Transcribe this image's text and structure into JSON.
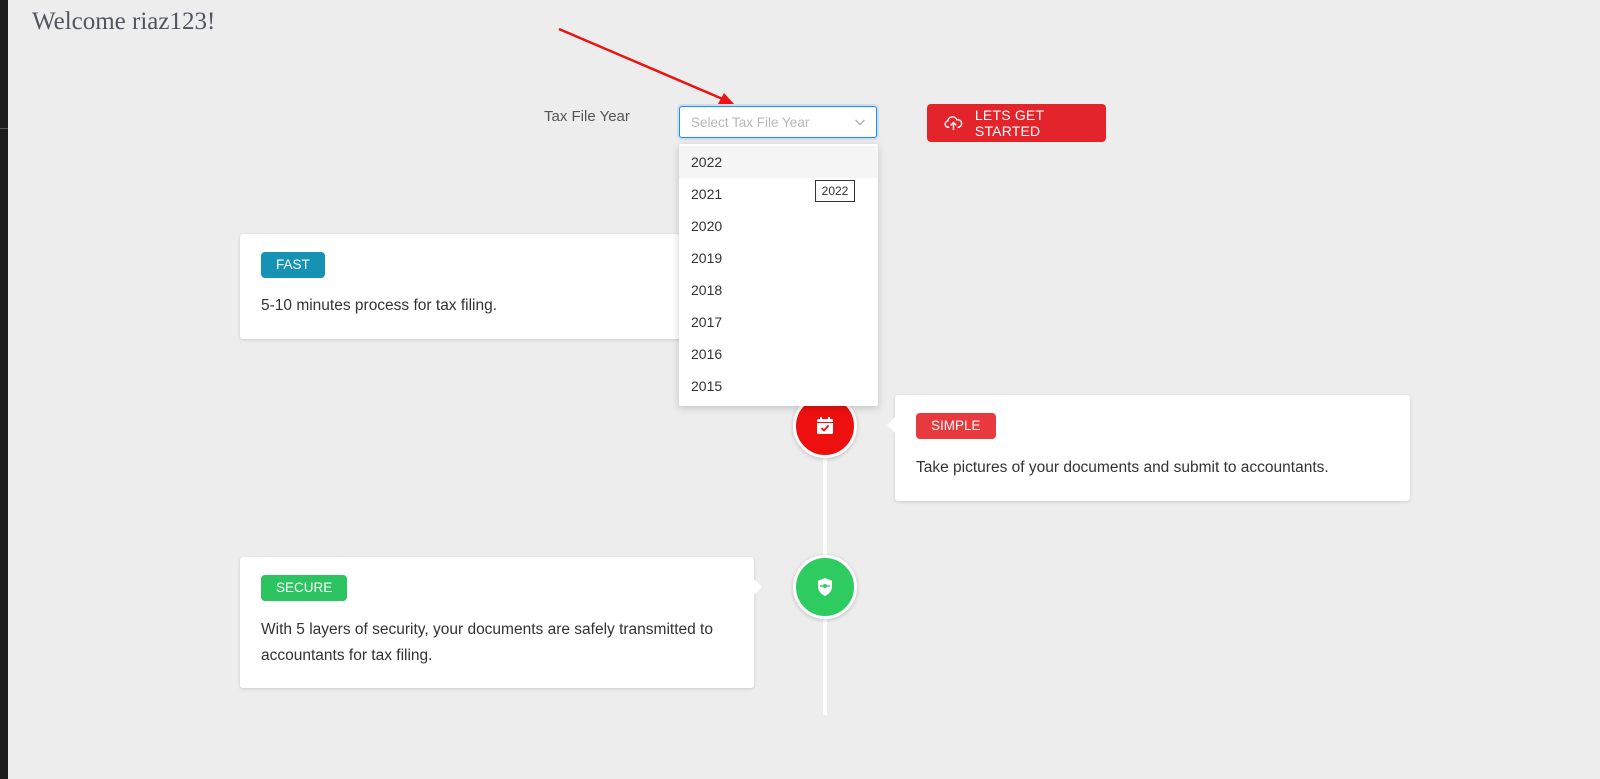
{
  "welcome": "Welcome riaz123!",
  "form": {
    "year_label": "Tax File Year",
    "select_placeholder": "Select Tax File Year",
    "start_button": "LETS GET STARTED"
  },
  "dropdown": {
    "options": [
      "2022",
      "2021",
      "2020",
      "2019",
      "2018",
      "2017",
      "2016",
      "2015"
    ],
    "tooltip": "2022"
  },
  "timeline": {
    "fast": {
      "badge": "FAST",
      "text": "5-10 minutes process for tax filing."
    },
    "simple": {
      "badge": "SIMPLE",
      "text": "Take pictures of your documents and submit to accountants."
    },
    "secure": {
      "badge": "SECURE",
      "text": "With 5 layers of security, your documents are safely transmitted to accountants for tax filing."
    }
  },
  "colors": {
    "primary_red": "#e3242b",
    "fast_badge": "#1693b4",
    "simple_badge": "#e8393e",
    "secure_badge": "#2bc460",
    "focus_border": "#1890ff"
  },
  "icons": {
    "button_icon": "cloud-upload-icon",
    "simple_node": "calendar-check-icon",
    "secure_node": "shield-icon",
    "select_chevron": "chevron-down-icon"
  }
}
